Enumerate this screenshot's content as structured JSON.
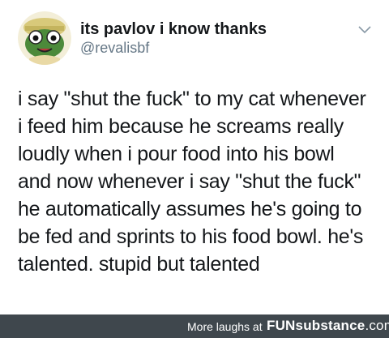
{
  "tweet": {
    "display_name": "its pavlov i know thanks",
    "handle": "@revalisbf",
    "avatar_icon": "cartoon-frog-avatar",
    "menu_icon": "chevron-down-icon",
    "lines": [
      "i say \"shut the fuck\" to my cat whenever",
      "i feed him because he screams really",
      "loudly when i pour food into his bowl",
      "and now whenever i say \"shut the fuck\"",
      "he automatically assumes he's going to",
      "be fed and sprints to his food bowl. he's",
      "talented. stupid but talented"
    ]
  },
  "footer": {
    "more_label": "More laughs at",
    "logo_fun": "FUN",
    "logo_substance": "substance",
    "logo_com": ".com",
    "background": "#3f474d"
  }
}
